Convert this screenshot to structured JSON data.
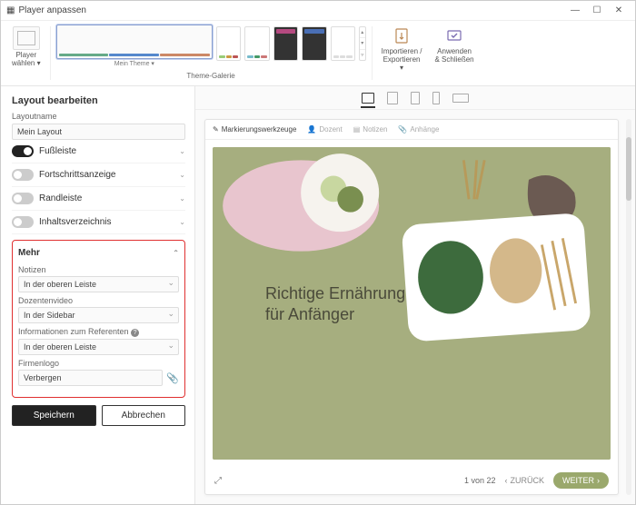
{
  "window": {
    "title": "Player anpassen"
  },
  "ribbon": {
    "choose_label": "Player\nwählen ▾",
    "theme_label": "Mein Theme ▾",
    "gallery_label": "Theme-Galerie",
    "import_label": "Importieren /\nExportieren\n▾",
    "apply_label": "Anwenden\n& Schließen"
  },
  "side": {
    "heading": "Layout bearbeiten",
    "layoutname_label": "Layoutname",
    "layoutname_value": "Mein Layout",
    "toggles": {
      "fussleiste": "Fußleiste",
      "fortschritt": "Fortschrittsanzeige",
      "randleiste": "Randleiste",
      "inhalt": "Inhaltsverzeichnis"
    },
    "mehr": {
      "title": "Mehr",
      "notizen_label": "Notizen",
      "notizen_value": "In der oberen Leiste",
      "dozent_label": "Dozentenvideo",
      "dozent_value": "In der Sidebar",
      "referent_label": "Informationen zum Referenten",
      "referent_value": "In der oberen Leiste",
      "logo_label": "Firmenlogo",
      "logo_value": "Verbergen"
    },
    "save": "Speichern",
    "cancel": "Abbrechen"
  },
  "preview": {
    "tabs": {
      "mark": "Markierungswerkzeuge",
      "dozent": "Dozent",
      "notizen": "Notizen",
      "anhange": "Anhänge"
    },
    "slide_title_1": "Richtige Ernährung",
    "slide_title_2": "für Anfänger",
    "page": "1 von 22",
    "back": "ZURÜCK",
    "next": "WEITER"
  }
}
